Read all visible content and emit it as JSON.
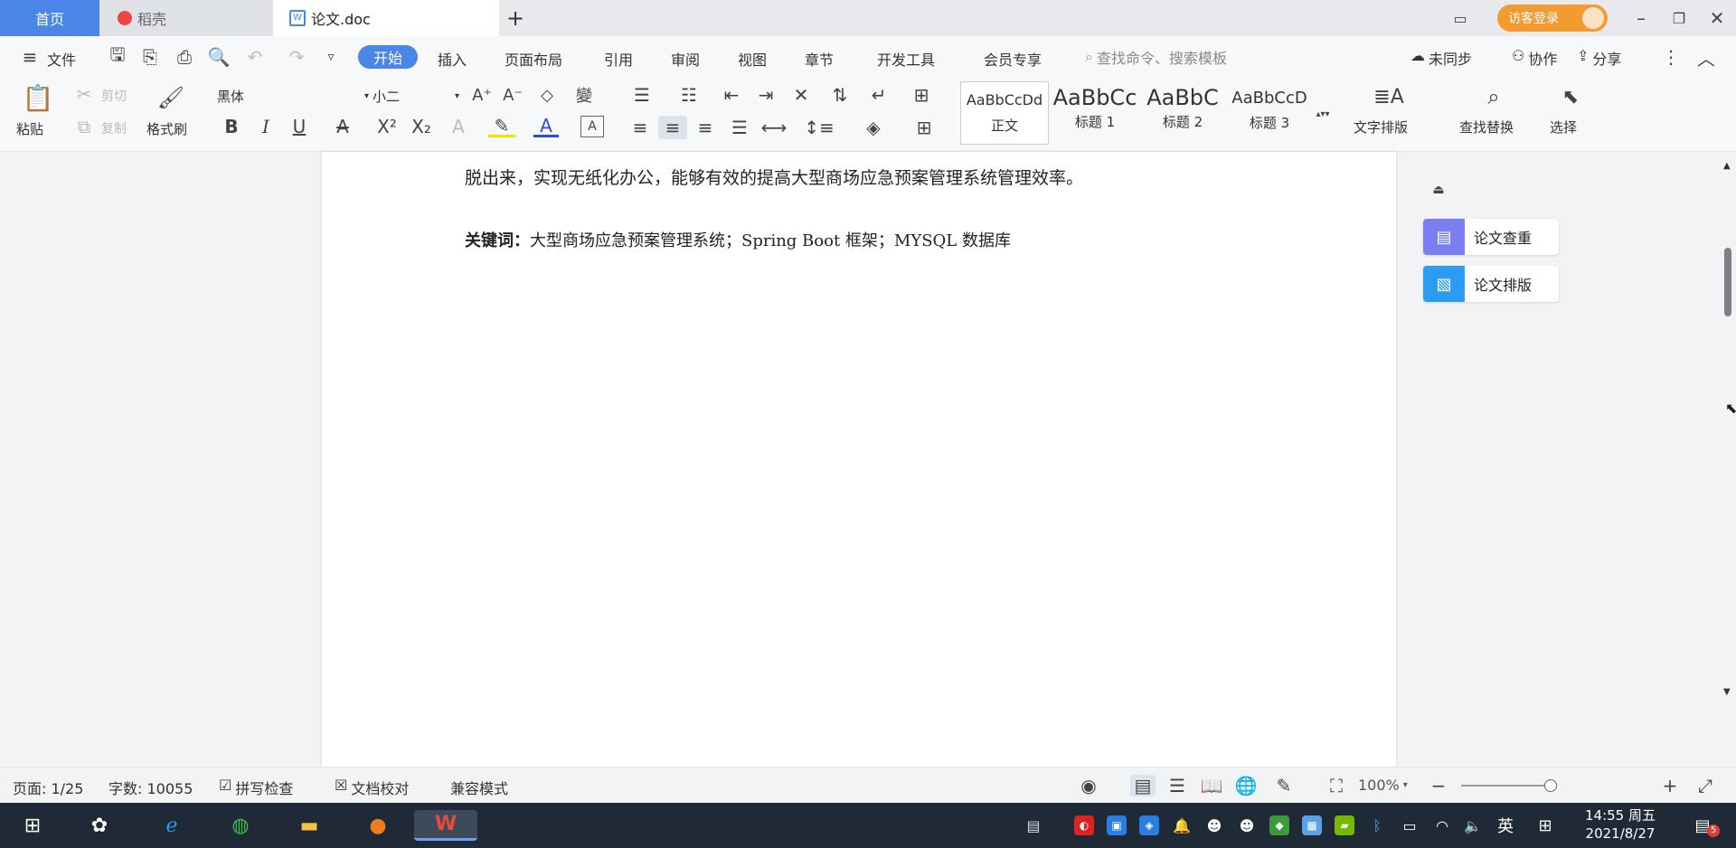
{
  "tabs": {
    "home": "首页",
    "daoke": "稻壳",
    "doc": "论文.doc",
    "add": "+"
  },
  "title_right": {
    "login": "访客登录"
  },
  "menu": {
    "file": "文件",
    "tabs": [
      "开始",
      "插入",
      "页面布局",
      "引用",
      "审阅",
      "视图",
      "章节",
      "开发工具",
      "会员专享"
    ],
    "active": "开始",
    "search_placeholder": "查找命令、搜索模板",
    "sync": "未同步",
    "collab": "协作",
    "share": "分享"
  },
  "ribbon": {
    "paste": "粘贴",
    "cut": "剪切",
    "copy": "复制",
    "format_painter": "格式刷",
    "font_name": "黑体",
    "font_size": "小二",
    "styles": [
      {
        "preview": "AaBbCcDd",
        "label": "正文"
      },
      {
        "preview": "AaBbCc",
        "label": "标题 1"
      },
      {
        "preview": "AaBbC",
        "label": "标题 2"
      },
      {
        "preview": "AaBbCcD",
        "label": "标题 3"
      }
    ],
    "text_layout": "文字排版",
    "find_replace": "查找替换",
    "select": "选择"
  },
  "document": {
    "body_line": "脱出来，实现无纸化办公，能够有效的提高大型商场应急预案管理系统管理效率。",
    "keywords_label": "关键词：",
    "keywords_text": "大型商场应急预案管理系统；Spring Boot 框架；MYSQL 数据库"
  },
  "right_panel": {
    "check": "论文查重",
    "layout": "论文排版"
  },
  "status_bar": {
    "page": "页面: 1/25",
    "words": "字数: 10055",
    "spell": "拼写检查",
    "proof": "文档校对",
    "compat": "兼容模式",
    "zoom": "100%"
  },
  "taskbar": {
    "ime": "英",
    "time": "14:55 周五",
    "date": "2021/8/27",
    "notif_count": "5"
  },
  "colors": {
    "accent": "#4a86e8",
    "tab_home": "#4a86e8",
    "login_btn": "#f39b2f",
    "check_icon": "#7b7ef0",
    "layout_icon": "#2d9bf0",
    "taskbar": "#1f2a36"
  }
}
